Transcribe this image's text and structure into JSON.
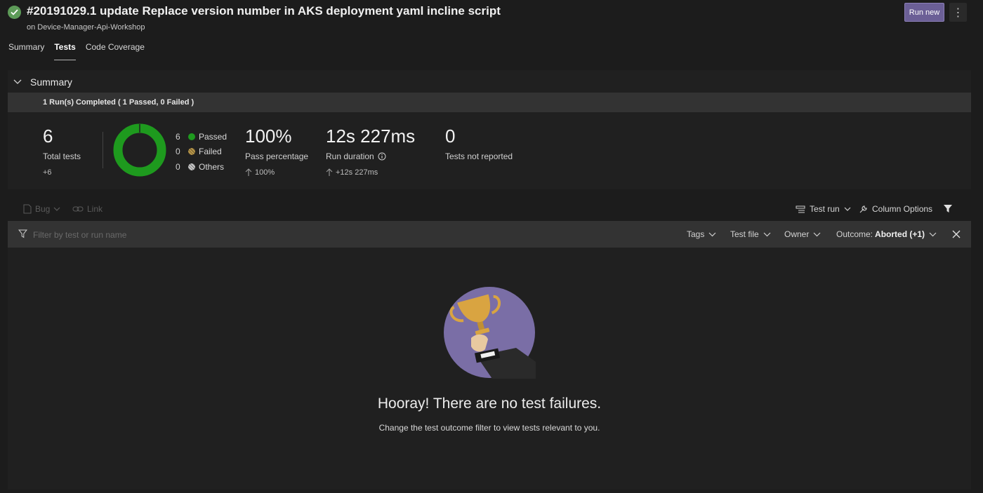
{
  "header": {
    "title": "#20191029.1 update Replace version number in AKS deployment yaml incline script",
    "subtitle": "on Device-Manager-Api-Workshop",
    "run_new_label": "Run new",
    "more_label": "⋮"
  },
  "tabs": [
    {
      "label": "Summary",
      "active": false
    },
    {
      "label": "Tests",
      "active": true
    },
    {
      "label": "Code Coverage",
      "active": false
    }
  ],
  "summary": {
    "section_label": "Summary",
    "runs_completed": "1 Run(s) Completed ( 1 Passed, 0 Failed )",
    "total_tests": {
      "value": "6",
      "label": "Total tests",
      "delta": "+6"
    },
    "legend": [
      {
        "count": "6",
        "label": "Passed",
        "color": "#1e9a1e"
      },
      {
        "count": "0",
        "label": "Failed",
        "color": "#b8964a"
      },
      {
        "count": "0",
        "label": "Others",
        "color": "#b0b0b0"
      }
    ],
    "pass_percentage": {
      "value": "100%",
      "label": "Pass percentage",
      "delta": "100%"
    },
    "run_duration": {
      "value": "12s 227ms",
      "label": "Run duration",
      "delta": "+12s 227ms"
    },
    "not_reported": {
      "value": "0",
      "label": "Tests not reported"
    }
  },
  "toolbar": {
    "bug_label": "Bug",
    "link_label": "Link",
    "test_run_label": "Test run",
    "column_options_label": "Column Options"
  },
  "filter": {
    "placeholder": "Filter by test or run name",
    "tags_label": "Tags",
    "test_file_label": "Test file",
    "owner_label": "Owner",
    "outcome_prefix": "Outcome:",
    "outcome_value": "Aborted (+1)"
  },
  "empty_state": {
    "heading": "Hooray! There are no test failures.",
    "hint": "Change the test outcome filter to view tests relevant to you."
  },
  "colors": {
    "accent": "#6b5f96",
    "passed": "#1e9a1e",
    "trophy_bg": "#7a6ea6",
    "trophy_gold": "#d9a441"
  }
}
